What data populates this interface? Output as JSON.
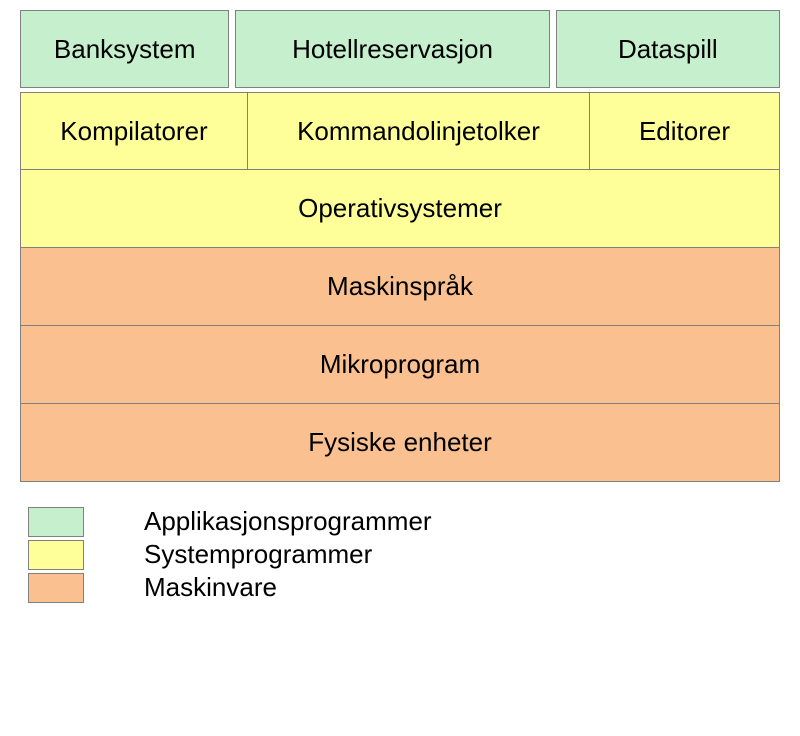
{
  "colors": {
    "applications": "#c6efce",
    "system": "#ffff99",
    "hardware": "#fac090"
  },
  "rows": [
    {
      "type": "multi",
      "category": "applications",
      "cells": [
        "Banksystem",
        "Hotellreservasjon",
        "Dataspill"
      ]
    },
    {
      "type": "multi",
      "category": "system",
      "cells": [
        "Kompilatorer",
        "Kommandolinjetolker",
        "Editorer"
      ]
    },
    {
      "type": "single",
      "category": "system",
      "label": "Operativsystemer"
    },
    {
      "type": "single",
      "category": "hardware",
      "label": "Maskinspråk"
    },
    {
      "type": "single",
      "category": "hardware",
      "label": "Mikroprogram"
    },
    {
      "type": "single",
      "category": "hardware",
      "label": "Fysiske enheter"
    }
  ],
  "legend": [
    {
      "category": "applications",
      "label": "Applikasjonsprogrammer"
    },
    {
      "category": "system",
      "label": "Systemprogrammer"
    },
    {
      "category": "hardware",
      "label": "Maskinvare"
    }
  ]
}
